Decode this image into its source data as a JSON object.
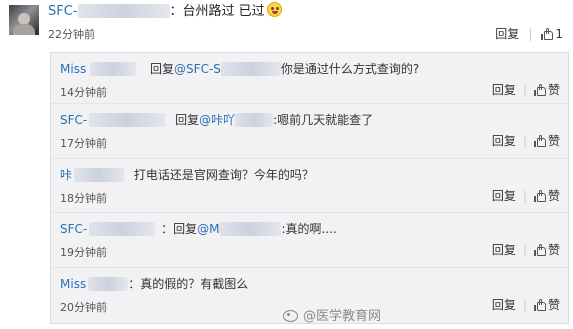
{
  "top_comment": {
    "user": "SFC-",
    "colon": "：",
    "text": "台州路过 已过",
    "emoji": "smile-emoji",
    "time": "22分钟前",
    "reply_label": "回复",
    "like_count": "1"
  },
  "replies": [
    {
      "user": "Miss",
      "pre": "回复",
      "target": "@SFC-S",
      "text": "你是通过什么方式查询的?",
      "time": "14分钟前",
      "reply_label": "回复",
      "like_label": "赞"
    },
    {
      "user": "SFC-",
      "pre": "回复",
      "target": "@咔吖",
      "text": ":嗯前几天就能查了",
      "time": "17分钟前",
      "reply_label": "回复",
      "like_label": "赞"
    },
    {
      "user": "咔",
      "pre": "",
      "target": "",
      "text": "打电话还是官网查询？今年的吗？",
      "time": "18分钟前",
      "reply_label": "回复",
      "like_label": "赞"
    },
    {
      "user": "SFC-",
      "pre": "：回复",
      "target": "@M",
      "text": ":真的啊....",
      "time": "19分钟前",
      "reply_label": "回复",
      "like_label": "赞"
    },
    {
      "user": "Miss",
      "pre": "",
      "target": "",
      "text": "：真的假的？有截图么",
      "time": "20分钟前",
      "reply_label": "回复",
      "like_label": "赞"
    }
  ],
  "watermark": "@医学教育网"
}
